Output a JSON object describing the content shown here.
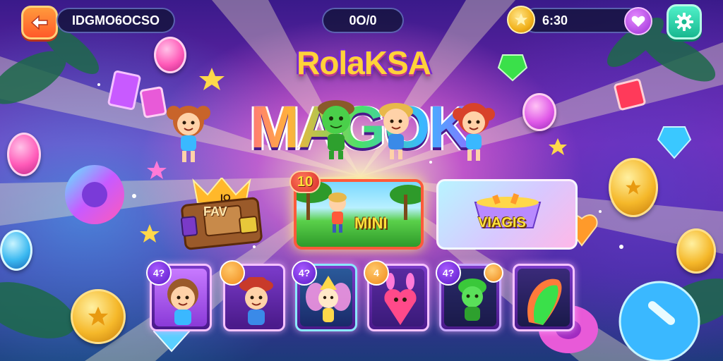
{
  "top_bar": {
    "player_name": "IDGMO6OCSO",
    "score": "0O/0",
    "timer": "6:30"
  },
  "titles": {
    "subtitle": "RolaKSA",
    "main": "MAGOK"
  },
  "modes": {
    "chest": {
      "label": "FAV",
      "number": "IO"
    },
    "mini": {
      "label": "MINI",
      "badge": "10"
    },
    "vaults": {
      "label": "VIAGIS"
    }
  },
  "slots": [
    {
      "badge": "4?",
      "badge_color": "purple",
      "character": "boy-brown-hair"
    },
    {
      "badge": "",
      "badge_color": "orange",
      "character": "boy-red-hat"
    },
    {
      "badge": "4?",
      "badge_color": "purple",
      "character": "yellow-fairy"
    },
    {
      "badge": "4",
      "badge_color": "orange",
      "character": "pink-creature"
    },
    {
      "badge": "4?",
      "badge_color": "purple",
      "character": "green-creature"
    },
    {
      "badge": "",
      "badge_color": "none",
      "character": "rainbow-candy"
    }
  ],
  "icons": {
    "back": "arrow-left-icon",
    "coin": "gold-coin-icon",
    "heart": "heart-icon",
    "settings": "gear-icon"
  },
  "colors": {
    "background_top": "#3a1a8a",
    "accent_orange": "#ff5a2a",
    "accent_teal": "#18b890",
    "accent_purple": "#9b2fd6",
    "gold": "#f5b82a"
  }
}
